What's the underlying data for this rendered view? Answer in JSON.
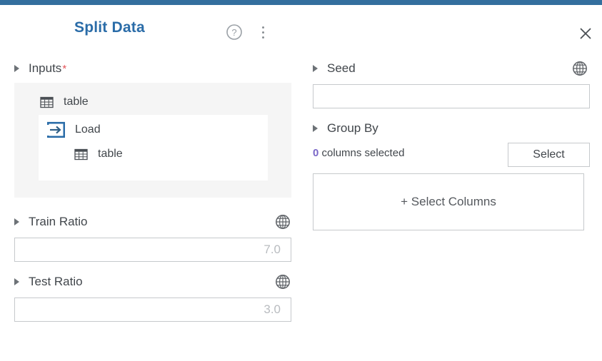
{
  "accent_color": "#336f9e",
  "title_color": "#2a6ca8",
  "header": {
    "title": "Split Data",
    "help_icon": "help-circle-icon",
    "menu_icon": "kebab-menu-icon",
    "close_icon": "close-icon"
  },
  "left": {
    "inputs": {
      "label": "Inputs",
      "required_marker": "*",
      "tree": [
        {
          "label": "table",
          "icon": "table-grid-icon",
          "level": 0
        },
        {
          "label": "Load",
          "icon": "load-arrow-icon",
          "level": 1
        },
        {
          "label": "table",
          "icon": "table-grid-icon",
          "level": 2
        }
      ]
    },
    "train_ratio": {
      "label": "Train Ratio",
      "globe_icon": "globe-icon",
      "value": "",
      "placeholder": "7.0"
    },
    "test_ratio": {
      "label": "Test Ratio",
      "globe_icon": "globe-icon",
      "value": "",
      "placeholder": "3.0"
    }
  },
  "right": {
    "seed": {
      "label": "Seed",
      "globe_icon": "globe-icon",
      "value": "",
      "placeholder": ""
    },
    "group_by": {
      "label": "Group By",
      "count": "0",
      "count_text": "columns selected",
      "select_button": "Select",
      "dropzone_label": "+ Select Columns"
    }
  }
}
